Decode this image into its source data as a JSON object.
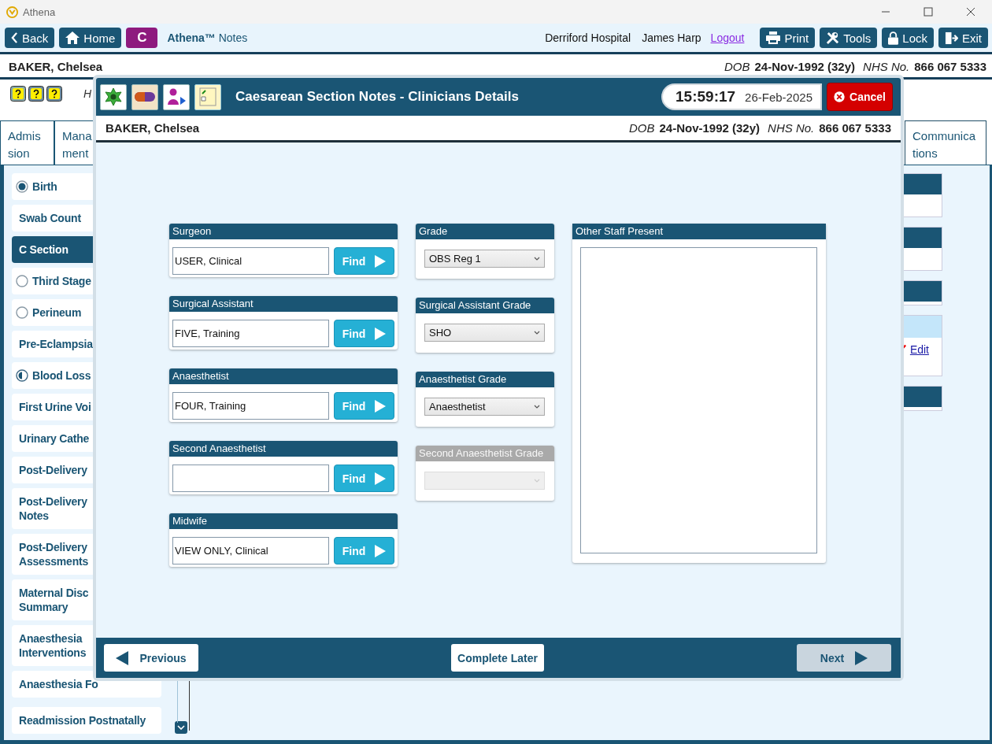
{
  "window": {
    "title": "Athena"
  },
  "toolbar": {
    "nav_buttons": [
      "Back",
      "Home"
    ],
    "badge": "C",
    "app_title": "**Athena™** Notes",
    "hospital": "Derriford Hospital",
    "user": "James Harp",
    "logout": "Logout",
    "actions": [
      "Print",
      "Tools",
      "Lock",
      "Exit"
    ]
  },
  "patient": {
    "name": "BAKER, Chelsea",
    "dob_label": "DOB",
    "dob": "24-Nov-1992 (32y)",
    "nhs_label": "NHS No.",
    "nhs": "866 067 5333"
  },
  "alert_bar": {
    "text": "H"
  },
  "tabs": [
    {
      "label": "Admission"
    },
    {
      "label": "Mana ment"
    }
  ],
  "tabs_right": [
    {
      "label": "Communications"
    }
  ],
  "sidebar": {
    "items": [
      {
        "label": "Birth",
        "kind": "radio",
        "checked": true,
        "partial": false,
        "selected": false
      },
      {
        "label": "Swab Count",
        "kind": "plain",
        "selected": false
      },
      {
        "label": "C Section",
        "kind": "plain",
        "selected": true
      },
      {
        "label": "Third Stage",
        "kind": "radio",
        "checked": false,
        "partial": false,
        "selected": false
      },
      {
        "label": "Perineum",
        "kind": "radio",
        "checked": false,
        "partial": false,
        "selected": false
      },
      {
        "label": "Pre-Eclampsia",
        "kind": "plain",
        "selected": false
      },
      {
        "label": "Blood Loss",
        "kind": "radio",
        "checked": false,
        "partial": true,
        "selected": false
      },
      {
        "label": "First Urine Voi",
        "kind": "plain",
        "selected": false
      },
      {
        "label": "Urinary Cathe",
        "kind": "plain",
        "selected": false
      },
      {
        "label": "Post-Delivery",
        "kind": "plain",
        "selected": false
      },
      {
        "label": "Post-Delivery Notes",
        "kind": "plain",
        "selected": false
      },
      {
        "label": "Post-Delivery Assessments",
        "kind": "plain",
        "selected": false
      },
      {
        "label": "Maternal Disc Summary",
        "kind": "plain",
        "selected": false
      },
      {
        "label": "Anaesthesia Interventions",
        "kind": "plain",
        "selected": false
      },
      {
        "label": "Anaesthesia Fo",
        "kind": "plain",
        "selected": false
      }
    ],
    "footer_item": {
      "label": "Readmission Postnatally",
      "selected": false
    }
  },
  "side_panels": [
    {
      "kind": "plain"
    },
    {
      "kind": "plain"
    },
    {
      "kind": "short"
    },
    {
      "kind": "edit",
      "link": "Edit"
    },
    {
      "kind": "short"
    }
  ],
  "dialog": {
    "title": "Caesarean Section Notes - Clinicians Details",
    "time": "15:59:17",
    "date": "26-Feb-2025",
    "cancel": "Cancel",
    "patient": {
      "name": "BAKER, Chelsea",
      "dob_label": "DOB",
      "dob": "24-Nov-1992 (32y)",
      "nhs_label": "NHS No.",
      "nhs": "866 067 5333"
    },
    "staff": [
      {
        "label": "Surgeon",
        "value": "USER, Clinical",
        "button": "Find"
      },
      {
        "label": "Surgical Assistant",
        "value": "FIVE, Training",
        "button": "Find"
      },
      {
        "label": "Anaesthetist",
        "value": "FOUR, Training",
        "button": "Find"
      },
      {
        "label": "Second Anaesthetist",
        "button": "Find"
      },
      {
        "label": "Midwife",
        "value": "VIEW ONLY, Clinical",
        "button": "Find"
      }
    ],
    "grades": [
      {
        "label": "Grade",
        "value": "OBS Reg 1",
        "disabled": false
      },
      {
        "label": "Surgical Assistant Grade",
        "value": "SHO",
        "disabled": false
      },
      {
        "label": "Anaesthetist Grade",
        "value": "Anaesthetist",
        "disabled": false
      },
      {
        "label": "Second Anaesthetist Grade",
        "disabled": true
      }
    ],
    "other_staff": {
      "label": "Other Staff Present"
    },
    "footer": {
      "previous": "Previous",
      "complete_later": "Complete Later",
      "next": {
        "label": "Next",
        "disabled": true
      }
    }
  }
}
